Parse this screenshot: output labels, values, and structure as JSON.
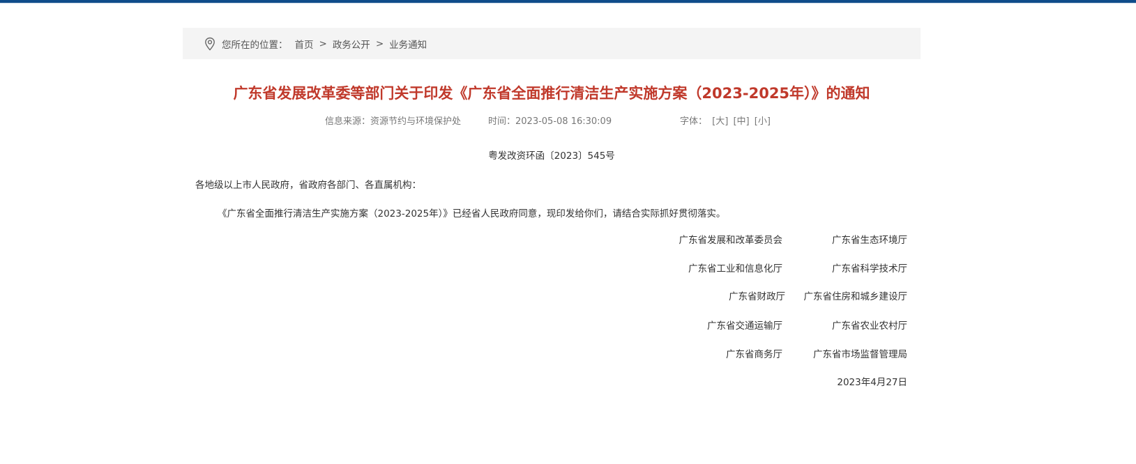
{
  "breadcrumb": {
    "location_label": "您所在的位置：",
    "items": [
      "首页",
      "政务公开",
      "业务通知"
    ],
    "separator": ">"
  },
  "article": {
    "title": "广东省发展改革委等部门关于印发《广东省全面推行清洁生产实施方案（2023-2025年）》的通知",
    "meta": {
      "source_label": "信息来源：",
      "source": "资源节约与环境保护处",
      "time_label": "时间：",
      "time": "2023-05-08 16:30:09",
      "font_label": "字体：",
      "font_sizes": [
        "[大]",
        "[中]",
        "[小]"
      ]
    },
    "doc_number": "粤发改资环函〔2023〕545号",
    "salutation": "各地级以上市人民政府，省政府各部门、各直属机构：",
    "paragraph": "《广东省全面推行清洁生产实施方案（2023-2025年）》已经省人民政府同意，现印发给你们，请结合实际抓好贯彻落实。",
    "signatories": [
      [
        "广东省发展和改革委员会",
        "广东省生态环境厅"
      ],
      [
        "广东省工业和信息化厅",
        "广东省科学技术厅"
      ],
      [
        "广东省财政厅",
        "广东省住房和城乡建设厅"
      ],
      [
        "广东省交通运输厅",
        "广东省农业农村厅"
      ],
      [
        "广东省商务厅",
        "广东省市场监督管理局"
      ]
    ],
    "date": "2023年4月27日"
  },
  "colors": {
    "top_bar": "#0f4c8a",
    "title": "#c0392b",
    "breadcrumb_bg": "#f4f4f4"
  },
  "icons": {
    "location": "location-pin-icon"
  }
}
